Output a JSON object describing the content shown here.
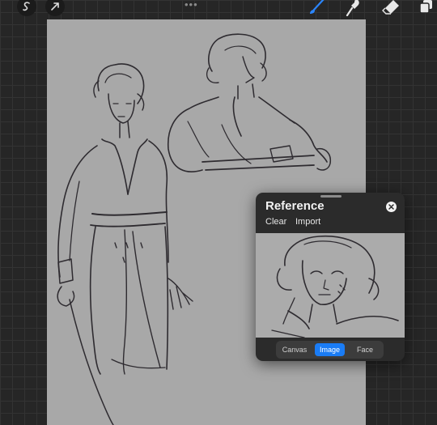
{
  "toolbar": {
    "left_icons": [
      "selection-s-icon",
      "transform-arrow-icon"
    ],
    "right_icons": [
      "brush-icon",
      "smudge-icon",
      "eraser-icon",
      "layers-icon"
    ],
    "active_tool": "brush",
    "accent_color": "#1a7cf5"
  },
  "reference": {
    "title": "Reference",
    "clear_label": "Clear",
    "import_label": "Import",
    "close_icon": "close-icon",
    "segments": [
      {
        "label": "Canvas",
        "active": false
      },
      {
        "label": "Image",
        "active": true
      },
      {
        "label": "Face",
        "active": false
      }
    ]
  },
  "colors": {
    "canvas": "#a8a8a8",
    "ink": "#2e2b30",
    "panel": "#2b2b2b",
    "background": "#262626"
  }
}
